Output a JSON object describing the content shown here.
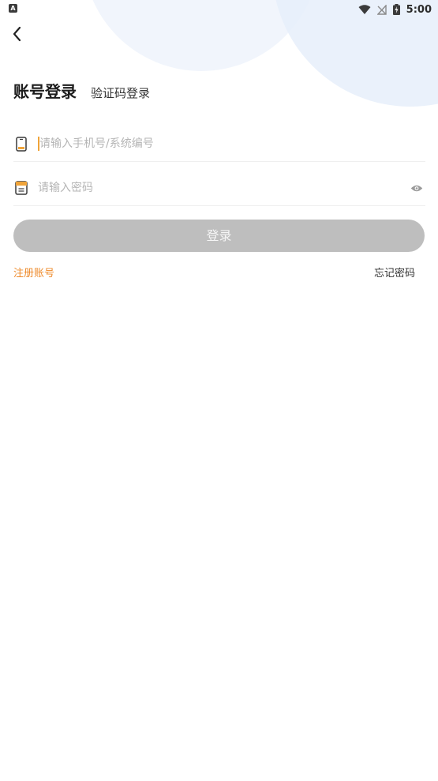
{
  "status_bar": {
    "left_badge": "A",
    "time": "5:00",
    "icons": [
      "wifi-icon",
      "no-signal-icon",
      "battery-icon"
    ]
  },
  "header": {
    "back_icon": "back-arrow-icon"
  },
  "tabs": {
    "account_login": "账号登录",
    "code_login": "验证码登录"
  },
  "form": {
    "phone_placeholder": "请输入手机号/系统编号",
    "phone_value": "",
    "password_placeholder": "请输入密码",
    "password_value": "",
    "phone_icon": "phone-icon",
    "lock_icon": "lock-icon",
    "eye_icon": "eye-icon"
  },
  "actions": {
    "login_label": "登录",
    "register_label": "注册账号",
    "forgot_label": "忘记密码"
  },
  "colors": {
    "accent": "#EE8A2A",
    "button_disabled": "#BEBEBE",
    "deco_circle": "#E8F0FB"
  }
}
